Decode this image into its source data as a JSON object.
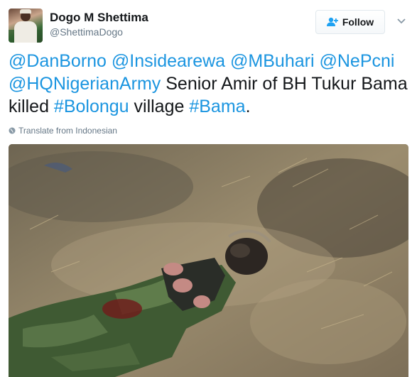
{
  "user": {
    "name": "Dogo M Shettima",
    "handle": "@ShettimaDogo",
    "follow_label": "Follow"
  },
  "tweet": {
    "segments": [
      {
        "text": "@DanBorno",
        "link": true
      },
      {
        "text": " ",
        "link": false
      },
      {
        "text": "@Insidearewa",
        "link": true
      },
      {
        "text": " ",
        "link": false
      },
      {
        "text": "@MBuhari",
        "link": true
      },
      {
        "text": " ",
        "link": false
      },
      {
        "text": "@NePcni",
        "link": true
      },
      {
        "text": " ",
        "link": false
      },
      {
        "text": "@HQNigerianArmy",
        "link": true
      },
      {
        "text": " Senior Amir of BH Tukur Bama killed ",
        "link": false
      },
      {
        "text": "#Bolongu",
        "link": true
      },
      {
        "text": " village ",
        "link": false
      },
      {
        "text": "#Bama",
        "link": true
      },
      {
        "text": ".",
        "link": false
      }
    ],
    "translate_label": "Translate from Indonesian"
  },
  "colors": {
    "link": "#1b95e0",
    "text": "#14171a",
    "muted": "#657786",
    "follow_icon": "#1da1f2"
  },
  "icons": {
    "follow": "add-user-icon",
    "caret": "chevron-down-icon",
    "translate": "globe-icon"
  }
}
